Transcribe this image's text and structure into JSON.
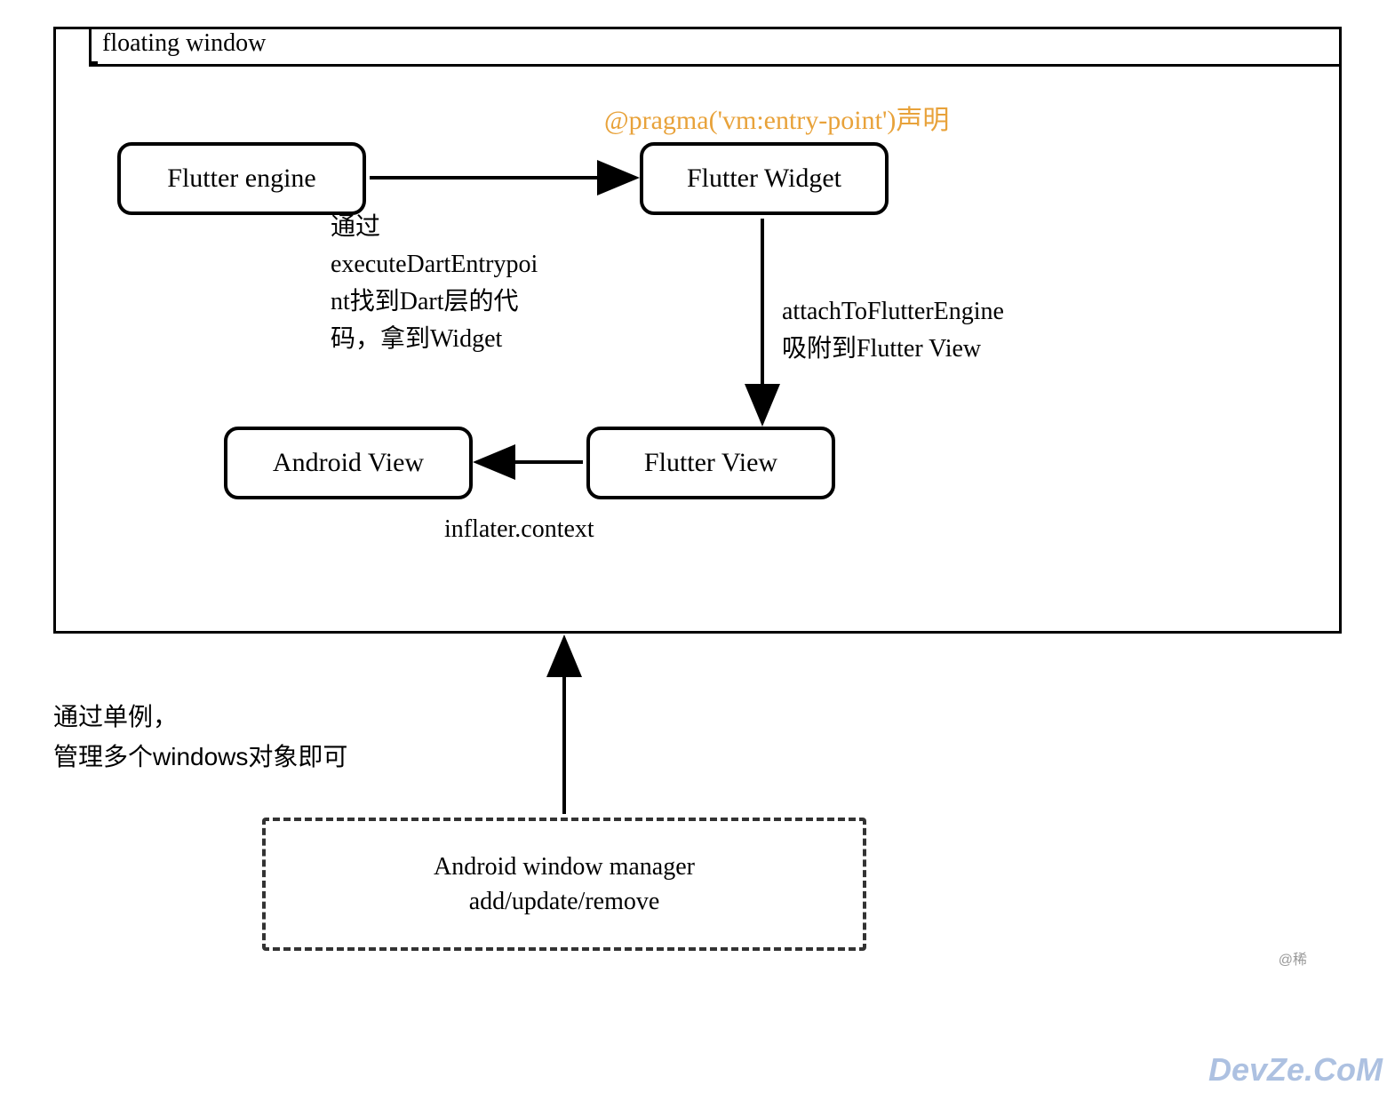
{
  "frame": {
    "title": "floating window"
  },
  "pragma": "@pragma('vm:entry-point')声明",
  "nodes": {
    "engine": "Flutter engine",
    "widget": "Flutter Widget",
    "aview": "Android View",
    "fview": "Flutter View",
    "manager_line1": "Android window manager",
    "manager_line2": "add/update/remove"
  },
  "edges": {
    "engine_to_widget": "通过\nexecuteDartEntrypoi\nnt找到Dart层的代\n码，拿到Widget",
    "widget_to_fview_line1": "attachToFlutterEngine",
    "widget_to_fview_line2": "吸附到Flutter View",
    "fview_to_aview": "inflater.context"
  },
  "note": "通过单例，\n管理多个windows对象即可",
  "watermark1": "@稀",
  "watermark2": "DevZe.CoM"
}
